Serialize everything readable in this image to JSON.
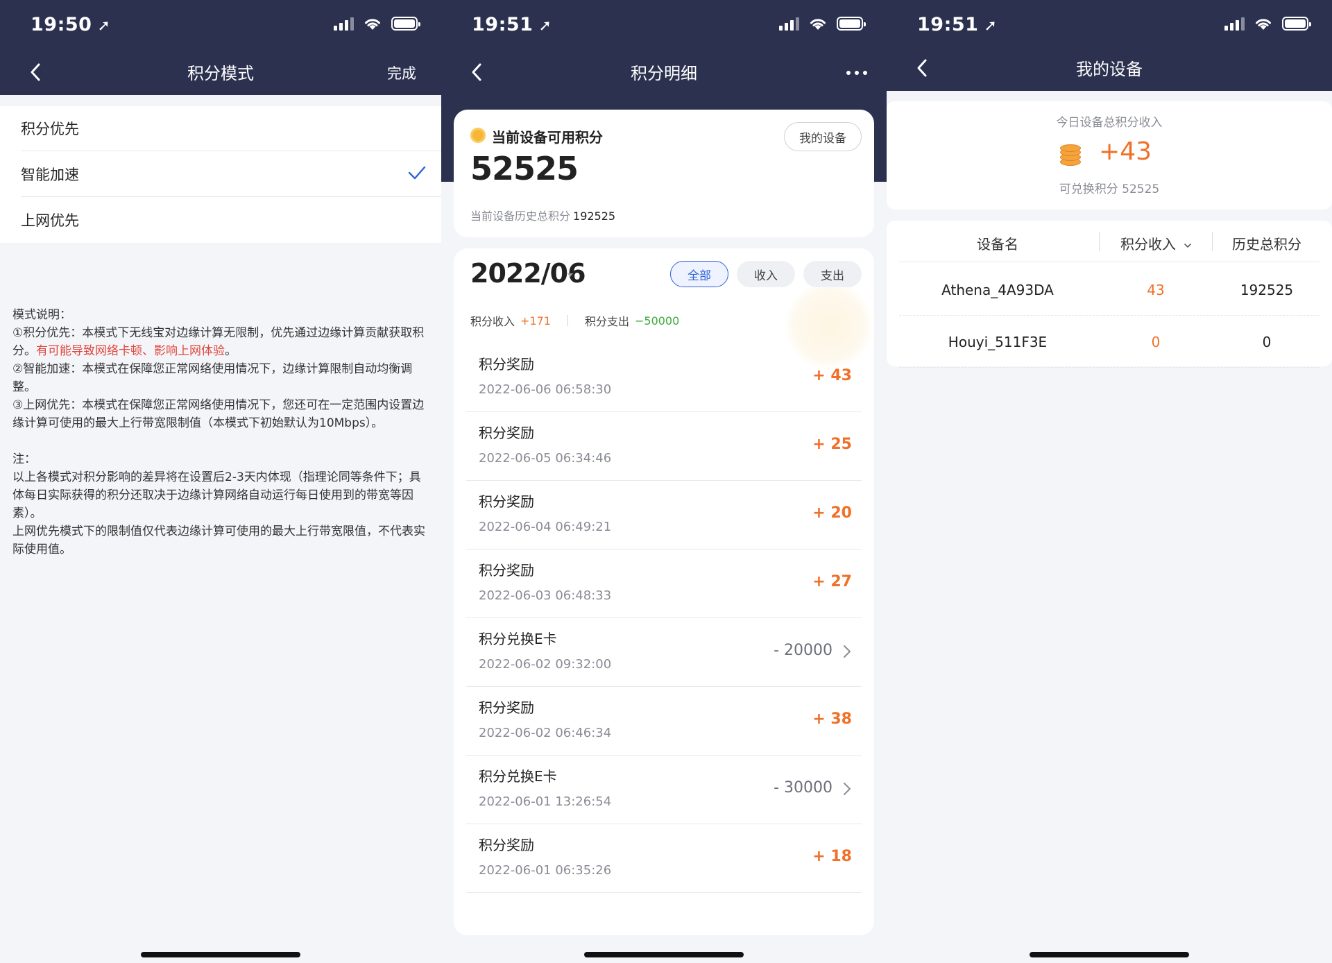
{
  "status": {
    "p1_time": "19:50",
    "p2_time": "19:51",
    "p3_time": "19:51"
  },
  "panel1": {
    "title": "积分模式",
    "done": "完成",
    "modes": [
      {
        "label": "积分优先",
        "selected": false
      },
      {
        "label": "智能加速",
        "selected": true
      },
      {
        "label": "上网优先",
        "selected": false
      }
    ],
    "desc_title": "模式说明：",
    "desc1_a": "①积分优先：本模式下无线宝对边缘计算无限制，优先通过边缘计算贡献获取积分。",
    "desc1_red": "有可能导致网络卡顿、影响上网体验",
    "desc1_b": "。",
    "desc2": "②智能加速：本模式在保障您正常网络使用情况下，边缘计算限制自动均衡调整。",
    "desc3": "③上网优先：本模式在保障您正常网络使用情况下，您还可在一定范围内设置边缘计算可使用的最大上行带宽限制值（本模式下初始默认为10Mbps）。",
    "note_title": "注：",
    "note1": "以上各模式对积分影响的差异将在设置后2-3天内体现（指理论同等条件下；具体每日实际获得的积分还取决于边缘计算网络自动运行每日使用到的带宽等因素）。",
    "note2": "上网优先模式下的限制值仅代表边缘计算可使用的最大上行带宽限值，不代表实际使用值。"
  },
  "panel2": {
    "title": "积分明细",
    "available_label": "当前设备可用积分",
    "available_value": "52525",
    "my_device_btn": "我的设备",
    "history_label": "当前设备历史总积分",
    "history_value": "192525",
    "month": "2022/06",
    "filters": [
      "全部",
      "收入",
      "支出"
    ],
    "income_label": "积分收入",
    "income_value": "+171",
    "expense_label": "积分支出",
    "expense_value": "−50000",
    "transactions": [
      {
        "title": "积分奖励",
        "date": "2022-06-06 06:58:30",
        "amount": "+ 43"
      },
      {
        "title": "积分奖励",
        "date": "2022-06-05 06:34:46",
        "amount": "+ 25"
      },
      {
        "title": "积分奖励",
        "date": "2022-06-04 06:49:21",
        "amount": "+ 20"
      },
      {
        "title": "积分奖励",
        "date": "2022-06-03 06:48:33",
        "amount": "+ 27"
      },
      {
        "title": "积分兑换E卡",
        "date": "2022-06-02 09:32:00",
        "amount": "- 20000"
      },
      {
        "title": "积分奖励",
        "date": "2022-06-02 06:46:34",
        "amount": "+ 38"
      },
      {
        "title": "积分兑换E卡",
        "date": "2022-06-01 13:26:54",
        "amount": "- 30000"
      },
      {
        "title": "积分奖励",
        "date": "2022-06-01 06:35:26",
        "amount": "+ 18"
      }
    ]
  },
  "panel3": {
    "title": "我的设备",
    "today_label": "今日设备总积分收入",
    "today_value": "+43",
    "redeem_text": "可兑换积分 52525",
    "columns": [
      "设备名",
      "积分收入",
      "历史总积分"
    ],
    "devices": [
      {
        "name": "Athena_4A93DA",
        "income": "43",
        "history": "192525"
      },
      {
        "name": "Houyi_511F3E",
        "income": "0",
        "history": "0"
      }
    ]
  },
  "colors": {
    "header": "#2c3150",
    "accent_orange": "#f07028",
    "accent_green": "#3aaa3a",
    "accent_blue": "#2f62d8",
    "warn_red": "#e0463c"
  }
}
